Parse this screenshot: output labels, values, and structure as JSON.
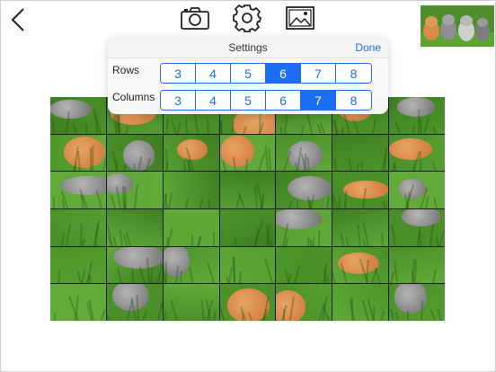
{
  "toolbar": {
    "back_icon": "chevron-left-icon",
    "camera_icon": "camera-icon",
    "settings_icon": "gear-icon",
    "image_icon": "picture-icon"
  },
  "settings": {
    "title": "Settings",
    "done_label": "Done",
    "rows_label": "Rows",
    "columns_label": "Columns",
    "options": [
      "3",
      "4",
      "5",
      "6",
      "7",
      "8"
    ],
    "rows_selected": "6",
    "columns_selected": "7"
  },
  "colors": {
    "accent": "#1b6ef3",
    "grass": "#4f9a2c",
    "kitten_grey": "#9a9a9a",
    "kitten_orange": "#d98a4a"
  }
}
